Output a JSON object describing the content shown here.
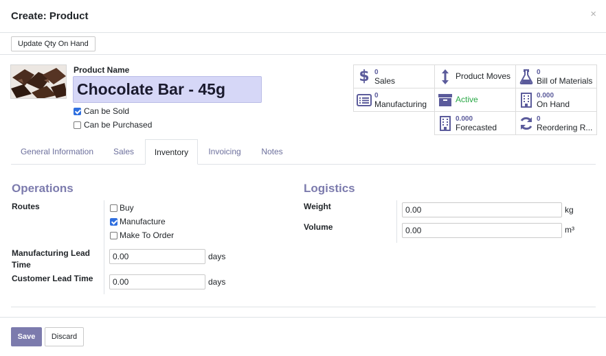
{
  "modal": {
    "title": "Create: Product",
    "close": "×"
  },
  "statusbar": {
    "update_qty_label": "Update Qty On Hand"
  },
  "product": {
    "name_label": "Product Name",
    "name_value": "Chocolate Bar - 45g",
    "can_be_sold": {
      "label": "Can be Sold",
      "checked": true
    },
    "can_be_purchased": {
      "label": "Can be Purchased",
      "checked": false
    }
  },
  "smart_buttons": {
    "sales": {
      "count": "0",
      "label": "Sales",
      "icon": "dollar-icon"
    },
    "product_moves": {
      "label": "Product Moves",
      "icon": "arrows-vertical-icon"
    },
    "bom": {
      "count": "0",
      "label": "Bill of Materials",
      "icon": "flask-icon"
    },
    "manufacturing": {
      "count": "0",
      "label": "Manufacturing",
      "icon": "list-alt-icon"
    },
    "active": {
      "label": "Active",
      "icon": "archive-icon",
      "color": "#28a745"
    },
    "on_hand": {
      "count": "0.000",
      "label": "On Hand",
      "icon": "building-icon"
    },
    "forecasted": {
      "count": "0.000",
      "label": "Forecasted",
      "icon": "building-icon"
    },
    "reordering": {
      "count": "0",
      "label": "Reordering R...",
      "icon": "refresh-icon"
    }
  },
  "tabs": [
    "General Information",
    "Sales",
    "Inventory",
    "Invoicing",
    "Notes"
  ],
  "active_tab": "Inventory",
  "operations": {
    "title": "Operations",
    "routes_label": "Routes",
    "routes": [
      {
        "label": "Buy",
        "checked": false
      },
      {
        "label": "Manufacture",
        "checked": true
      },
      {
        "label": "Make To Order",
        "checked": false
      }
    ],
    "mfg_lead_label": "Manufacturing Lead Time",
    "mfg_lead_value": "0.00",
    "mfg_lead_unit": "days",
    "cust_lead_label": "Customer Lead Time",
    "cust_lead_value": "0.00",
    "cust_lead_unit": "days"
  },
  "logistics": {
    "title": "Logistics",
    "weight_label": "Weight",
    "weight_value": "0.00",
    "weight_unit": "kg",
    "volume_label": "Volume",
    "volume_value": "0.00",
    "volume_unit": "m³"
  },
  "footer": {
    "save_label": "Save",
    "discard_label": "Discard"
  },
  "colors": {
    "accent": "#7c7bad",
    "name_field_bg": "#d6d7f7",
    "checkbox": "#2f6fdf"
  }
}
